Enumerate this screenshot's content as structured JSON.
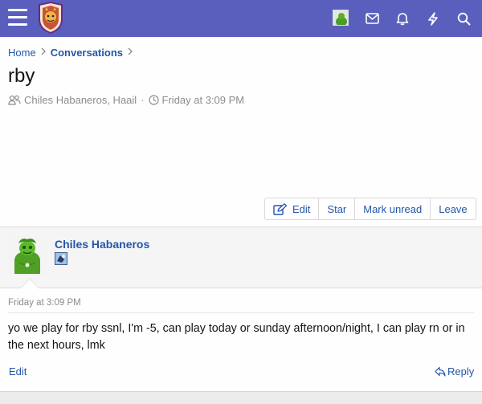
{
  "header": {
    "icons": [
      "menu-icon",
      "site-logo",
      "user-avatar",
      "inbox-icon",
      "bell-icon",
      "bolt-icon",
      "search-icon"
    ]
  },
  "breadcrumb": {
    "items": [
      "Home",
      "Conversations"
    ]
  },
  "thread": {
    "title": "rby",
    "participants": "Chiles Habaneros, Haail",
    "date": "Friday at 3:09 PM"
  },
  "actions": {
    "edit": "Edit",
    "star": "Star",
    "mark_unread": "Mark unread",
    "leave": "Leave"
  },
  "message": {
    "author": "Chiles Habaneros",
    "date": "Friday at 3:09 PM",
    "body": "yo we play for rby ssnl, I'm -5, can play today or sunday afternoon/night, I can play rn or in the next hours, lmk",
    "edit_label": "Edit",
    "reply_label": "Reply"
  },
  "colors": {
    "header_bg": "#5a5fbe",
    "link": "#2456a8",
    "muted": "#8c8c8c"
  }
}
